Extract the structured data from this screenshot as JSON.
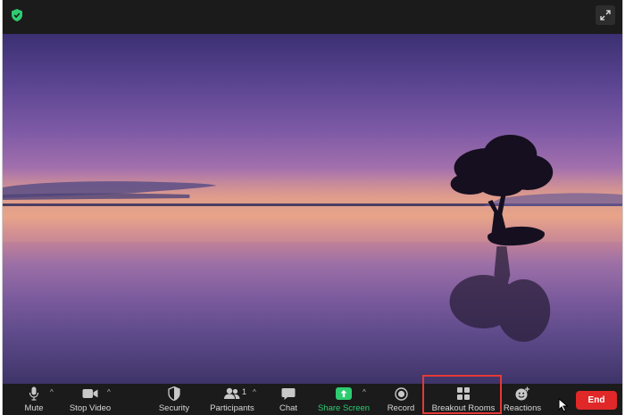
{
  "window": {
    "title": ""
  },
  "toolbar": {
    "mute_label": "Mute",
    "stop_video_label": "Stop Video",
    "security_label": "Security",
    "participants_label": "Participants",
    "participants_count": "1",
    "chat_label": "Chat",
    "share_screen_label": "Share Screen",
    "record_label": "Record",
    "breakout_rooms_label": "Breakout Rooms",
    "reactions_label": "Reactions",
    "end_label": "End",
    "caret": "^"
  },
  "icons": {
    "security_status": "shield-check-icon",
    "fullscreen": "expand-icon",
    "mute": "microphone-icon",
    "video": "video-camera-icon",
    "security": "shield-icon",
    "participants": "people-icon",
    "chat": "chat-bubble-icon",
    "share": "share-screen-icon",
    "record": "record-icon",
    "breakout": "grid-icon",
    "reactions": "emoji-plus-icon"
  },
  "colors": {
    "share_green": "#2ecc71",
    "end_red": "#e02828",
    "highlight_red": "#e53935",
    "toolbar_bg": "#1b1b1b"
  }
}
